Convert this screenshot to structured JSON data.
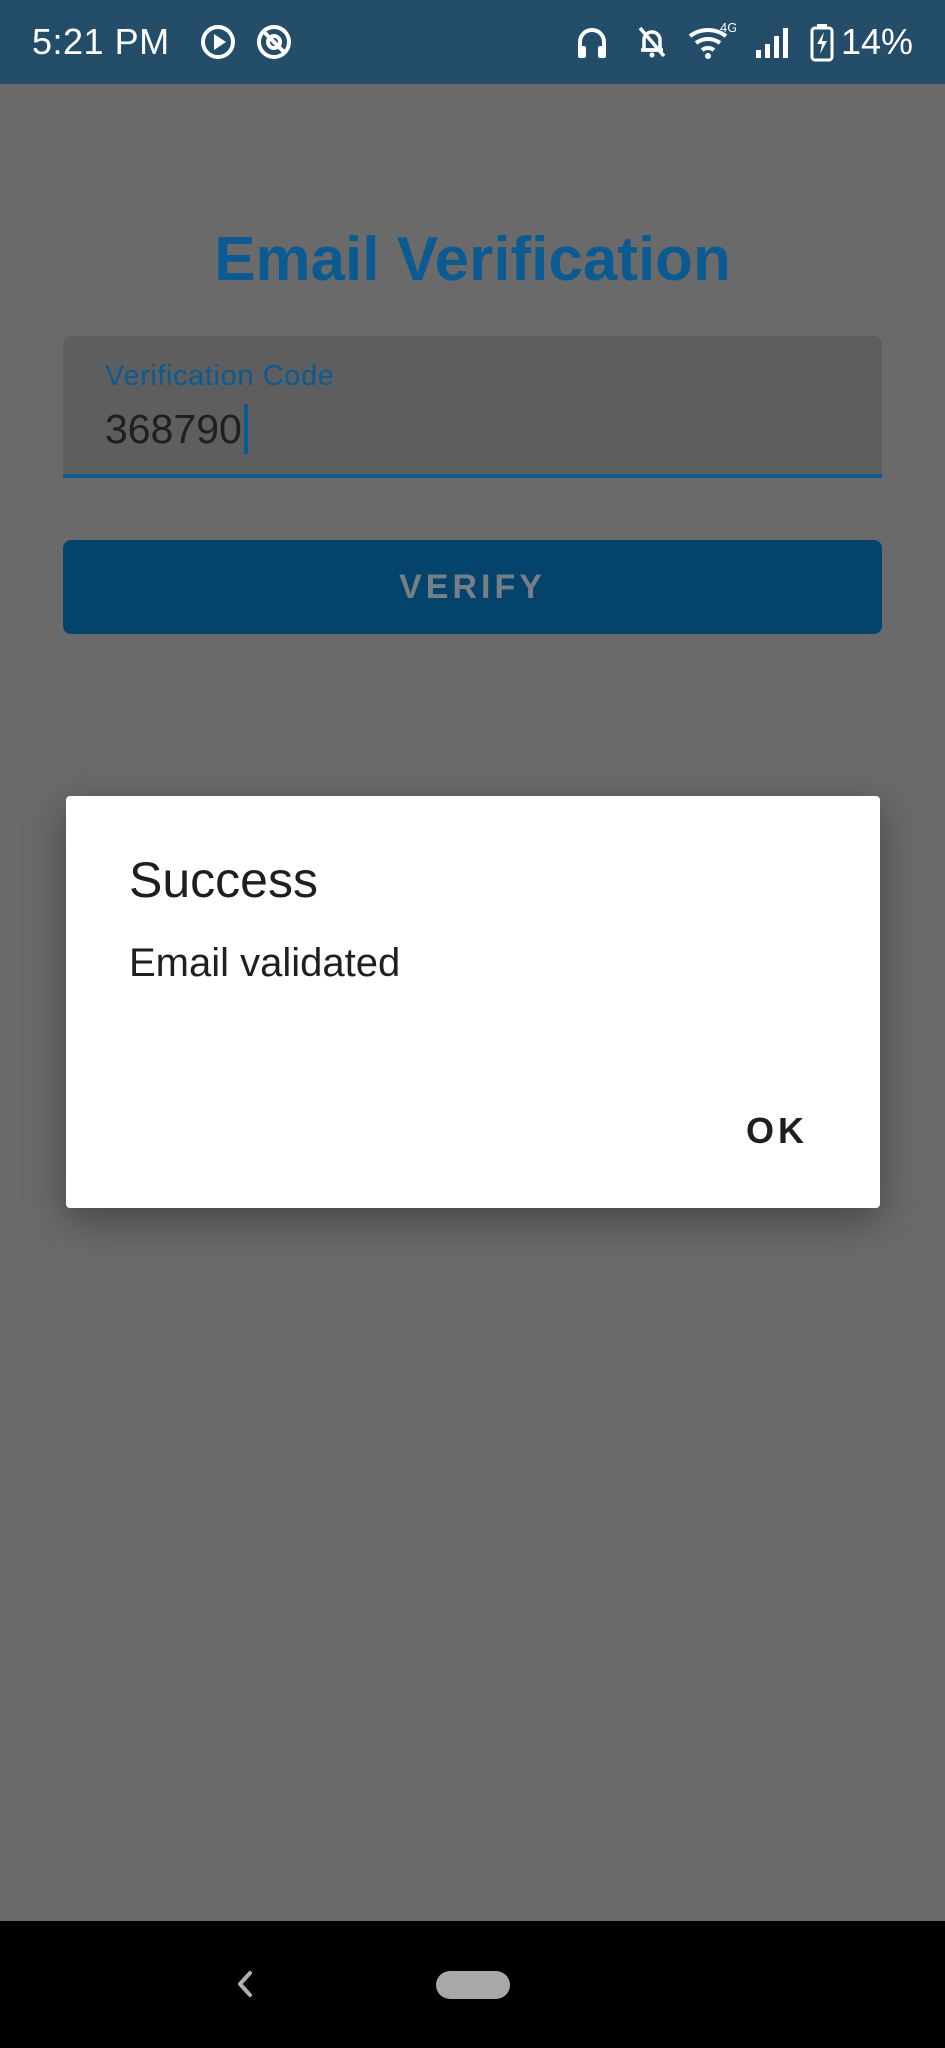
{
  "status_bar": {
    "time": "5:21 PM",
    "battery": "14%",
    "network_type": "4G",
    "icons": [
      "media-play-icon",
      "at-sign-icon",
      "headset-icon",
      "notifications-off-icon",
      "wifi-icon",
      "signal-icon",
      "battery-charging-icon"
    ]
  },
  "page": {
    "title": "Email Verification",
    "code_field": {
      "label": "Verification Code",
      "value": "368790"
    },
    "verify_button_label": "VERIFY"
  },
  "dialog": {
    "title": "Success",
    "message": "Email validated",
    "ok_label": "OK"
  },
  "nav_bar": {
    "icons": [
      "back-icon",
      "home-pill-icon"
    ]
  },
  "colors": {
    "status_bar": "#244d69",
    "accent": "#0c5a92",
    "button": "#04436c",
    "scrim": "#6a6a6a",
    "dialog_bg": "#ffffff"
  }
}
